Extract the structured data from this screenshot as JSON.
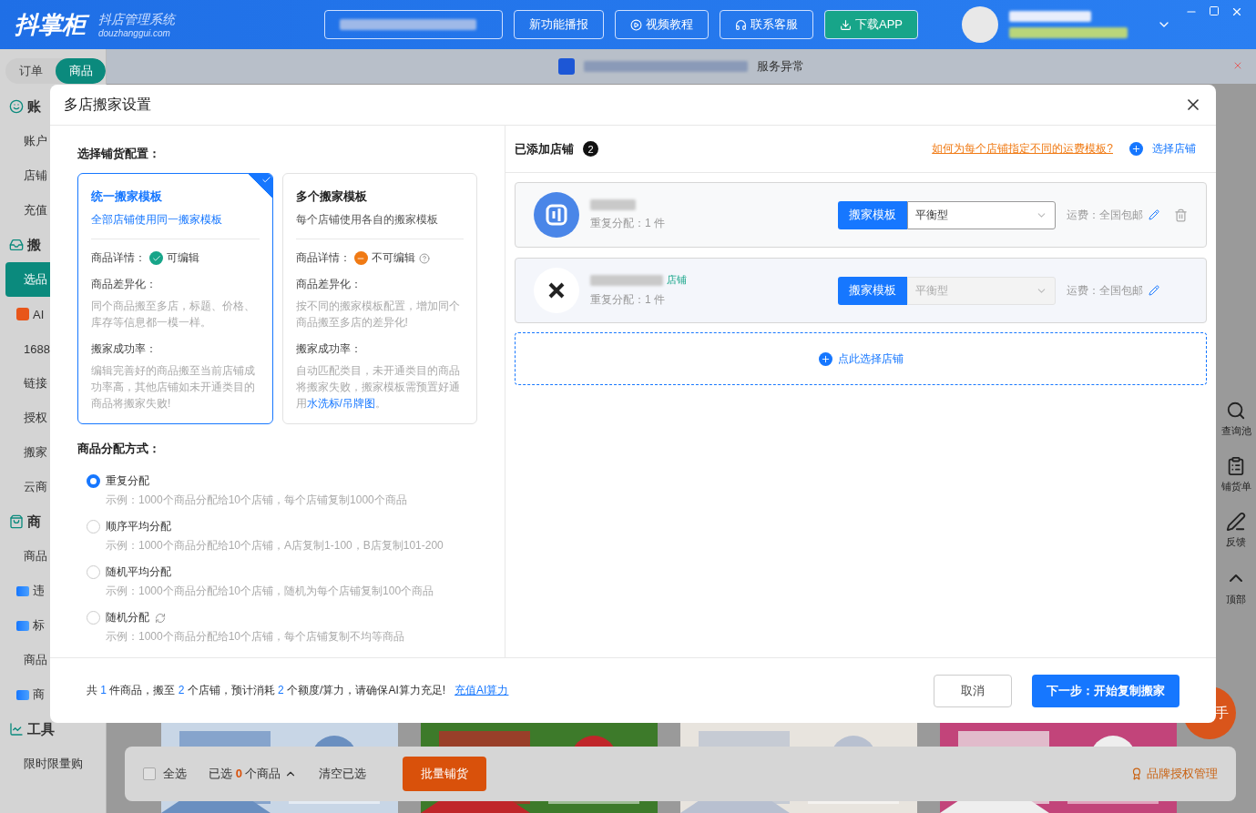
{
  "header": {
    "logo": "抖掌柜",
    "logo_subtitle": "抖店管理系统",
    "logo_domain": "douzhanggui.com",
    "buttons": [
      {
        "label": "新功能播报",
        "kind": "plain"
      },
      {
        "label": "视频教程",
        "kind": "video"
      },
      {
        "label": "联系客服",
        "kind": "support"
      },
      {
        "label": "下载APP",
        "kind": "download"
      }
    ]
  },
  "sidebar": {
    "tabs": [
      {
        "label": "订单",
        "selected": false
      },
      {
        "label": "商品",
        "selected": true
      }
    ],
    "items": [
      {
        "label": "账",
        "kind": "group"
      },
      {
        "label": "账户",
        "kind": "item"
      },
      {
        "label": "店铺",
        "kind": "item"
      },
      {
        "label": "充值",
        "kind": "item"
      },
      {
        "label": "搬",
        "kind": "group"
      },
      {
        "label": "选品",
        "kind": "item",
        "selected": true
      },
      {
        "label": "AI",
        "kind": "badge"
      },
      {
        "label": "1688",
        "kind": "item"
      },
      {
        "label": "链接",
        "kind": "item"
      },
      {
        "label": "授权",
        "kind": "item"
      },
      {
        "label": "搬家",
        "kind": "item"
      },
      {
        "label": "云商",
        "kind": "item"
      },
      {
        "label": "商",
        "kind": "group"
      },
      {
        "label": "商品",
        "kind": "item"
      },
      {
        "label": "违",
        "kind": "ai"
      },
      {
        "label": "标",
        "kind": "ai"
      },
      {
        "label": "商品",
        "kind": "item"
      },
      {
        "label": "商",
        "kind": "ai"
      },
      {
        "label": "工具",
        "kind": "group"
      },
      {
        "label": "限时限量购",
        "kind": "item"
      }
    ]
  },
  "notice": {
    "text": "服务异常"
  },
  "side_tools": [
    {
      "label": "查询池",
      "kind": "search"
    },
    {
      "label": "铺货单",
      "kind": "list"
    },
    {
      "label": "反馈",
      "kind": "edit"
    },
    {
      "label": "顶部",
      "kind": "top"
    }
  ],
  "help_button": {
    "label": "手"
  },
  "bottom_bar": {
    "checked": false,
    "select_all": "全选",
    "selected_prefix": "已选",
    "selected_count": "0",
    "selected_suffix": "个商品",
    "clear": "清空已选",
    "batch": "批量铺货",
    "brand": "品牌授权管理"
  },
  "dialog": {
    "title": "多店搬家设置",
    "config_title": "选择铺货配置：",
    "configs": [
      {
        "title": "统一搬家模板",
        "subtitle": "全部店铺使用同一搬家模板",
        "selected": true,
        "detail_label": "商品详情：",
        "editable": true,
        "detail_text": "可编辑",
        "diff_label": "商品差异化：",
        "diff_text": "同个商品搬至多店，标题、价格、库存等信息都一模一样。",
        "rate_label": "搬家成功率：",
        "rate_text": "编辑完善好的商品搬至当前店铺成功率高，其他店铺如未开通类目的商品将搬家失败!"
      },
      {
        "title": "多个搬家模板",
        "subtitle": "每个店铺使用各自的搬家模板",
        "selected": false,
        "detail_label": "商品详情：",
        "editable": false,
        "detail_text": "不可编辑",
        "diff_label": "商品差异化：",
        "diff_text": "按不同的搬家模板配置，增加同个商品搬至多店的差异化!",
        "rate_label": "搬家成功率：",
        "rate_text": "自动匹配类目，未开通类目的商品将搬家失败，搬家模板需预置好通用",
        "rate_link": "水洗标/吊牌图",
        "rate_suffix": "。"
      }
    ],
    "dist_title": "商品分配方式：",
    "distributions": [
      {
        "label": "重复分配",
        "example": "示例：1000个商品分配给10个店铺，每个店铺复制1000个商品",
        "selected": true,
        "kind": "plain"
      },
      {
        "label": "顺序平均分配",
        "example": "示例：1000个商品分配给10个店铺，A店复制1-100，B店复制101-200",
        "selected": false,
        "kind": "plain"
      },
      {
        "label": "随机平均分配",
        "example": "示例：1000个商品分配给10个店铺，随机为每个店铺复制100个商品",
        "selected": false,
        "kind": "plain"
      },
      {
        "label": "随机分配",
        "example": "示例：1000个商品分配给10个店铺，每个店铺复制不均等商品",
        "selected": false,
        "kind": "refresh"
      }
    ],
    "stores_title": "已添加店铺",
    "stores_count": "2",
    "freight_link": "如何为每个店铺指定不同的运费模板?",
    "choose_store": "选择店铺",
    "stores": [
      {
        "kind": "logo",
        "count": "重复分配：1 件",
        "template_button": "搬家模板",
        "template": "平衡型",
        "disabled": false,
        "freight": "运费：全国包邮",
        "deletable": true
      },
      {
        "kind": "plain",
        "tag": "店铺",
        "count": "重复分配：1 件",
        "template_button": "搬家模板",
        "template": "平衡型",
        "disabled": true,
        "freight": "运费：全国包邮",
        "deletable": false
      }
    ],
    "add_store": "点此选择店铺",
    "summary": [
      {
        "text": "共 ",
        "highlight": false
      },
      {
        "text": "1",
        "highlight": true
      },
      {
        "text": " 件商品，搬至 ",
        "highlight": false
      },
      {
        "text": "2",
        "highlight": true
      },
      {
        "text": " 个店铺，预计消耗 ",
        "highlight": false
      },
      {
        "text": "2",
        "highlight": true
      },
      {
        "text": " 个额度/算力，请确保AI算力充足!",
        "highlight": false
      }
    ],
    "recharge_link": "充值AI算力",
    "cancel": "取消",
    "next": "下一步：开始复制搬家"
  }
}
